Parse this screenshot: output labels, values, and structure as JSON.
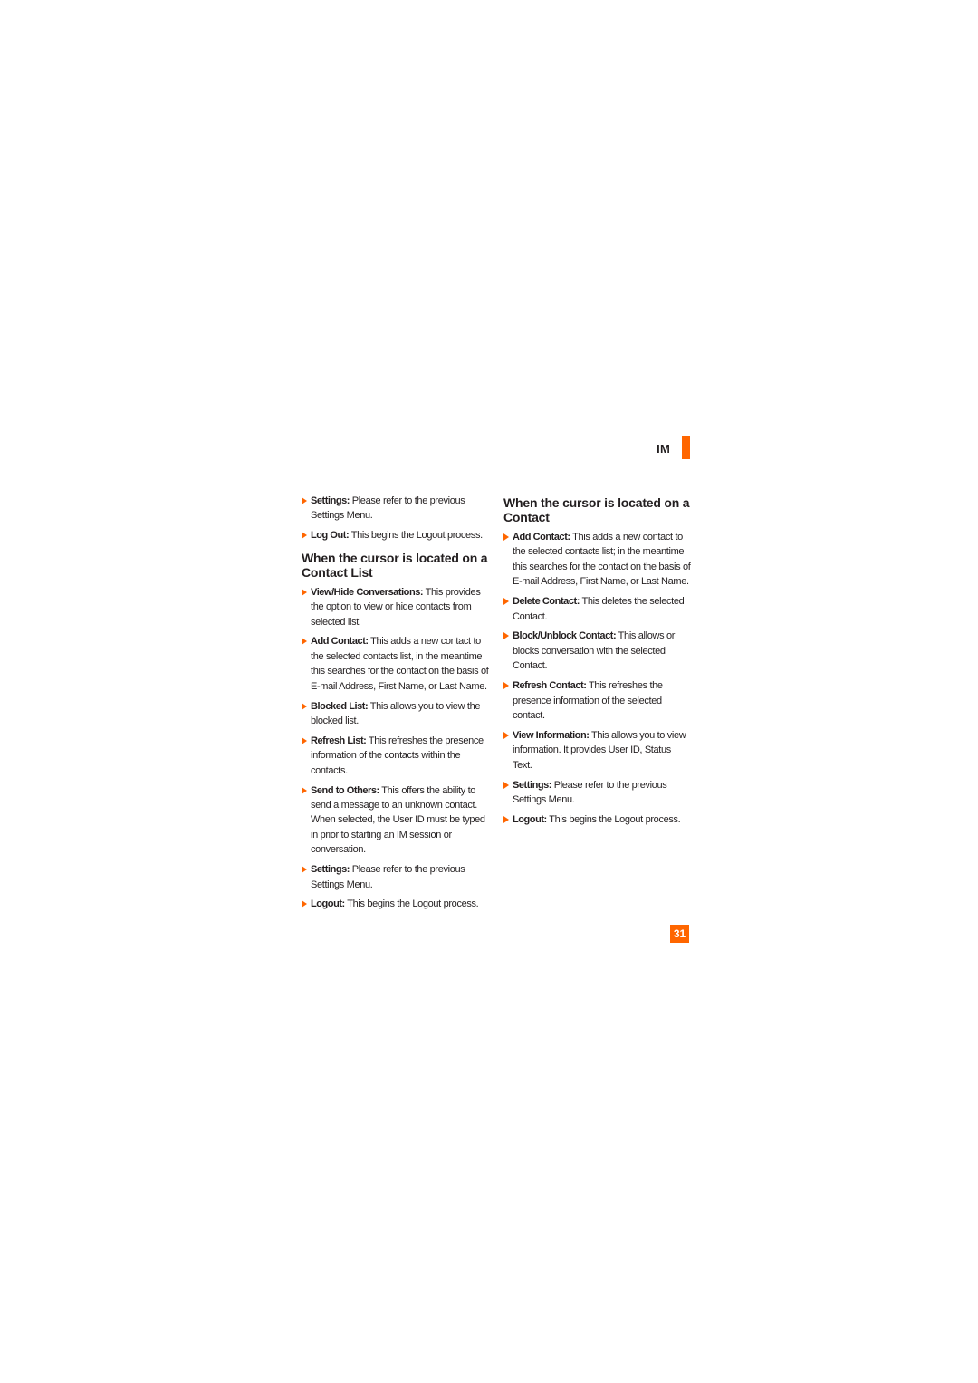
{
  "section_tag": {
    "label": "IM",
    "accent_color": "#ff6600"
  },
  "left_column": {
    "top_items": [
      {
        "term": "Settings:",
        "text": " Please refer to the previous Settings Menu."
      },
      {
        "term": "Log Out:",
        "text": " This begins the Logout process."
      }
    ],
    "heading": "When the cursor is located on a Contact List",
    "items": [
      {
        "term": "View/Hide Conversations:",
        "text": " This provides the option to view or hide contacts from selected list."
      },
      {
        "term": "Add Contact:",
        "text": " This adds a new contact to the selected contacts list, in the meantime this searches for the contact on the basis of E-mail Address, First Name, or Last Name."
      },
      {
        "term": "Blocked List:",
        "text": " This allows you to view the blocked list."
      },
      {
        "term": "Refresh List:",
        "text": " This refreshes the presence information of the contacts within the contacts."
      },
      {
        "term": "Send to Others:",
        "text": " This offers the ability to send a message to an unknown contact. When selected, the User ID must be typed in prior to starting an IM session or conversation."
      },
      {
        "term": "Settings:",
        "text": " Please refer to the previous Settings Menu."
      },
      {
        "term": "Logout:",
        "text": " This begins the Logout process."
      }
    ]
  },
  "right_column": {
    "heading": "When the cursor is located on a Contact",
    "items": [
      {
        "term": "Add Contact:",
        "text": " This adds a new contact to the selected contacts list; in the meantime this searches for the contact on the basis of E-mail Address, First Name, or Last Name."
      },
      {
        "term": "Delete Contact:",
        "text": " This deletes the selected Contact."
      },
      {
        "term": "Block/Unblock Contact:",
        "text": " This allows or blocks conversation with the selected Contact."
      },
      {
        "term": "Refresh Contact:",
        "text": " This refreshes the presence information of the selected contact."
      },
      {
        "term": "View Information:",
        "text": " This allows you to view information. It provides User ID, Status Text."
      },
      {
        "term": "Settings:",
        "text": " Please refer to the previous Settings Menu."
      },
      {
        "term": "Logout:",
        "text": " This begins the Logout process."
      }
    ]
  },
  "page_number": "31"
}
